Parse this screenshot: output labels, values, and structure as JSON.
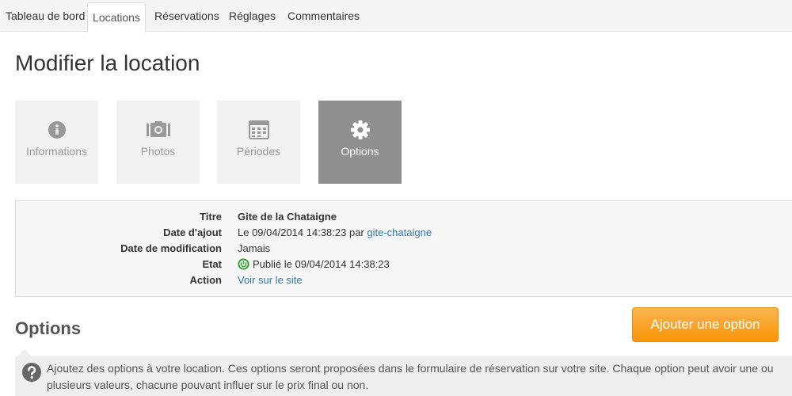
{
  "nav": {
    "tabs": [
      {
        "label": "Tableau de bord",
        "active": false
      },
      {
        "label": "Locations",
        "active": true
      },
      {
        "label": "Réservations",
        "active": false
      },
      {
        "label": "Réglages",
        "active": false
      },
      {
        "label": "Commentaires",
        "active": false
      }
    ]
  },
  "page": {
    "title": "Modifier la location"
  },
  "steps": [
    {
      "label": "Informations",
      "icon": "info-icon",
      "active": false
    },
    {
      "label": "Photos",
      "icon": "camera-icon",
      "active": false
    },
    {
      "label": "Périodes",
      "icon": "calendar-icon",
      "active": false
    },
    {
      "label": "Options",
      "icon": "gear-icon",
      "active": true
    }
  ],
  "details": {
    "titre_label": "Titre",
    "titre_value": "Gite de la Chataigne",
    "ajout_label": "Date d'ajout",
    "ajout_value": "Le 09/04/2014 14:38:23 par",
    "ajout_author": "gite-chataigne",
    "modif_label": "Date de modification",
    "modif_value": "Jamais",
    "etat_label": "Etat",
    "etat_value": "Publié le 09/04/2014 14:38:23",
    "action_label": "Action",
    "action_link": "Voir sur le site"
  },
  "options": {
    "title": "Options",
    "add_button": "Ajouter une option",
    "help": "Ajoutez des options à votre location. Ces options seront proposées dans le formulaire de réservation sur votre site. Chaque option peut avoir une ou plusieurs valeurs, chacune pouvant influer sur le prix final ou non."
  },
  "colors": {
    "accent_orange": "#f89406",
    "link_blue": "#2a7ab0",
    "published_green": "#2e9e2e",
    "active_tile": "#8f8f8f"
  }
}
